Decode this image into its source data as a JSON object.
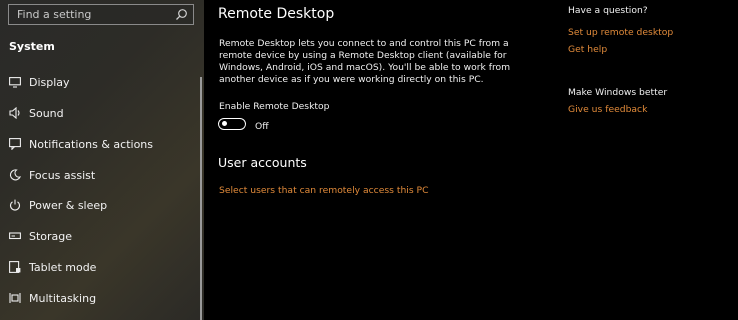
{
  "sidebar": {
    "search": {
      "placeholder": "Find a setting",
      "icon": "search-icon"
    },
    "section_title": "System",
    "items": [
      {
        "label": "Display",
        "icon": "display-icon"
      },
      {
        "label": "Sound",
        "icon": "sound-icon"
      },
      {
        "label": "Notifications & actions",
        "icon": "notifications-icon"
      },
      {
        "label": "Focus assist",
        "icon": "moon-icon"
      },
      {
        "label": "Power & sleep",
        "icon": "power-icon"
      },
      {
        "label": "Storage",
        "icon": "storage-icon"
      },
      {
        "label": "Tablet mode",
        "icon": "tablet-icon"
      },
      {
        "label": "Multitasking",
        "icon": "multitasking-icon"
      }
    ]
  },
  "main": {
    "title": "Remote Desktop",
    "description": "Remote Desktop lets you connect to and control this PC from a remote device by using a Remote Desktop client (available for Windows, Android, iOS and macOS). You'll be able to work from another device as if you were working directly on this PC.",
    "toggle": {
      "label": "Enable Remote Desktop",
      "state": "Off"
    },
    "user_accounts": {
      "heading": "User accounts",
      "link": "Select users that can remotely access this PC"
    }
  },
  "help": {
    "question_heading": "Have a question?",
    "links": [
      "Set up remote desktop",
      "Get help"
    ],
    "better_heading": "Make Windows better",
    "feedback_link": "Give us feedback"
  },
  "colors": {
    "accent": "#e08a3a",
    "background": "#000000",
    "text": "#ffffff"
  }
}
